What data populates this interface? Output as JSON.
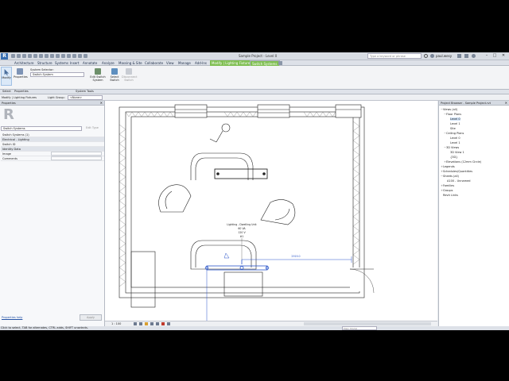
{
  "titlebar": {
    "app_logo": "R",
    "title": "Sample Project - Level 0",
    "search_placeholder": "Type a keyword or phrase",
    "user": "paul.wesy",
    "minimize": "–",
    "maximize": "□",
    "close": "✕"
  },
  "tabs": [
    {
      "label": "Architecture"
    },
    {
      "label": "Structure"
    },
    {
      "label": "Systems"
    },
    {
      "label": "Insert"
    },
    {
      "label": "Annotate"
    },
    {
      "label": "Analyze"
    },
    {
      "label": "Massing & Site"
    },
    {
      "label": "Collaborate"
    },
    {
      "label": "View"
    },
    {
      "label": "Manage"
    },
    {
      "label": "Add-Ins"
    },
    {
      "label": "Modify | Lighting Fixtures"
    },
    {
      "label": "Switch Systems"
    }
  ],
  "ribbon": {
    "modify": "Modify",
    "properties": "Properties",
    "system_selector_label": "System Selector:",
    "system_selector_value": "Switch System",
    "edit_switch_system": "Edit Switch System",
    "select_switch": "Select Switch",
    "disconnect_switch": "Disconnect Switch",
    "panels": {
      "select": "Select",
      "properties": "Properties",
      "system_tools": "System Tools"
    },
    "colors": {
      "context_tab": "#7fbf52",
      "accent": "#3a6fb0"
    }
  },
  "options_bar": {
    "context": "Modify | Lighting Fixtures",
    "light_group_label": "Light Group:",
    "light_group_value": "<None>"
  },
  "properties": {
    "header": "Properties",
    "type_selector": "Switch Systems",
    "edit_type": "Edit Type",
    "rows": [
      {
        "label": "Switch Systems (1)"
      },
      {
        "label": "Electrical - Lighting",
        "category": true
      },
      {
        "label": "Switch ID"
      },
      {
        "label": "Identity Data",
        "category": true
      },
      {
        "label": "Image"
      },
      {
        "label": "Comments"
      }
    ],
    "help": "Properties help",
    "apply": "Apply"
  },
  "canvas": {
    "fixture_label": "Lighting - Dwelling Unit",
    "fixture_watts": "60 VA",
    "fixture_volts": "120 V",
    "fixture_id": "#1",
    "dimension": "2919.0",
    "scale": "1 : 100"
  },
  "browser": {
    "header": "Project Browser - Sample Project.rvt",
    "tree": [
      {
        "label": "Views (all)",
        "level": 0,
        "twist": "−"
      },
      {
        "label": "Floor Plans",
        "level": 1,
        "twist": "−"
      },
      {
        "label": "Level 0",
        "level": 2,
        "selected": true
      },
      {
        "label": "Level 1",
        "level": 2
      },
      {
        "label": "Site",
        "level": 2
      },
      {
        "label": "Ceiling Plans",
        "level": 1,
        "twist": "−"
      },
      {
        "label": "Level 0",
        "level": 2
      },
      {
        "label": "Level 1",
        "level": 2
      },
      {
        "label": "3D Views",
        "level": 1,
        "twist": "−"
      },
      {
        "label": "3D View 1",
        "level": 2
      },
      {
        "label": "{3D}",
        "level": 2
      },
      {
        "label": "Elevations (12mm Circle)",
        "level": 1,
        "twist": "+"
      },
      {
        "label": "Legends",
        "level": 0,
        "twist": "+"
      },
      {
        "label": "Schedules/Quantities",
        "level": 0,
        "twist": "+"
      },
      {
        "label": "Sheets (all)",
        "level": 0,
        "twist": "−"
      },
      {
        "label": "A100 - Unnamed",
        "level": 1
      },
      {
        "label": "Families",
        "level": 0,
        "twist": "+"
      },
      {
        "label": "Groups",
        "level": 0,
        "twist": "+"
      },
      {
        "label": "Revit Links",
        "level": 0
      }
    ]
  },
  "status": {
    "text": "Click to select, TAB for alternates, CTRL adds, SHIFT unselects.",
    "model": "Main Model"
  }
}
